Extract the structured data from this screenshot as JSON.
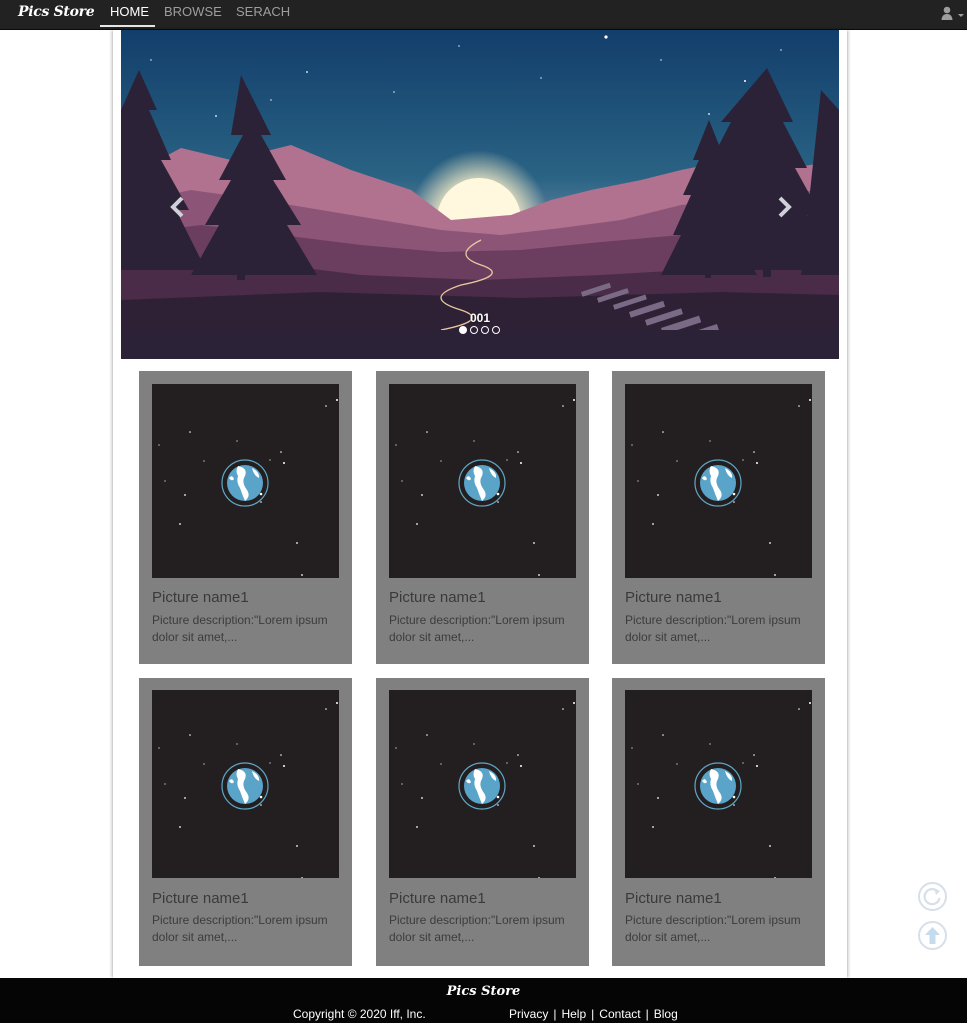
{
  "navbar": {
    "brand": "Pics Store",
    "items": [
      {
        "label": "HOME",
        "active": true
      },
      {
        "label": "BROWSE",
        "active": false
      },
      {
        "label": "SERACH",
        "active": false
      }
    ],
    "user_icon": "user-icon"
  },
  "carousel": {
    "caption": "001",
    "slide_count": 4,
    "active_index": 0,
    "prev_icon": "chevron-left-icon",
    "next_icon": "chevron-right-icon"
  },
  "cards": [
    {
      "name": "Picture name1",
      "description": "Picture description:\"Lorem ipsum dolor sit amet,..."
    },
    {
      "name": "Picture name1",
      "description": "Picture description:\"Lorem ipsum dolor sit amet,..."
    },
    {
      "name": "Picture name1",
      "description": "Picture description:\"Lorem ipsum dolor sit amet,..."
    },
    {
      "name": "Picture name1",
      "description": "Picture description:\"Lorem ipsum dolor sit amet,..."
    },
    {
      "name": "Picture name1",
      "description": "Picture description:\"Lorem ipsum dolor sit amet,..."
    },
    {
      "name": "Picture name1",
      "description": "Picture description:\"Lorem ipsum dolor sit amet,..."
    }
  ],
  "floating": {
    "refresh_icon": "refresh-icon",
    "top_icon": "arrow-up-icon"
  },
  "footer": {
    "brand": "Pics Store",
    "copyright": "Copyright © 2020 Iff, Inc.",
    "links": [
      "Privacy",
      "Help",
      "Contact",
      "Blog"
    ]
  },
  "colors": {
    "navbar_bg": "#222222",
    "card_bg": "#808080",
    "thumb_bg": "#231f20",
    "footer_bg": "#050505"
  }
}
